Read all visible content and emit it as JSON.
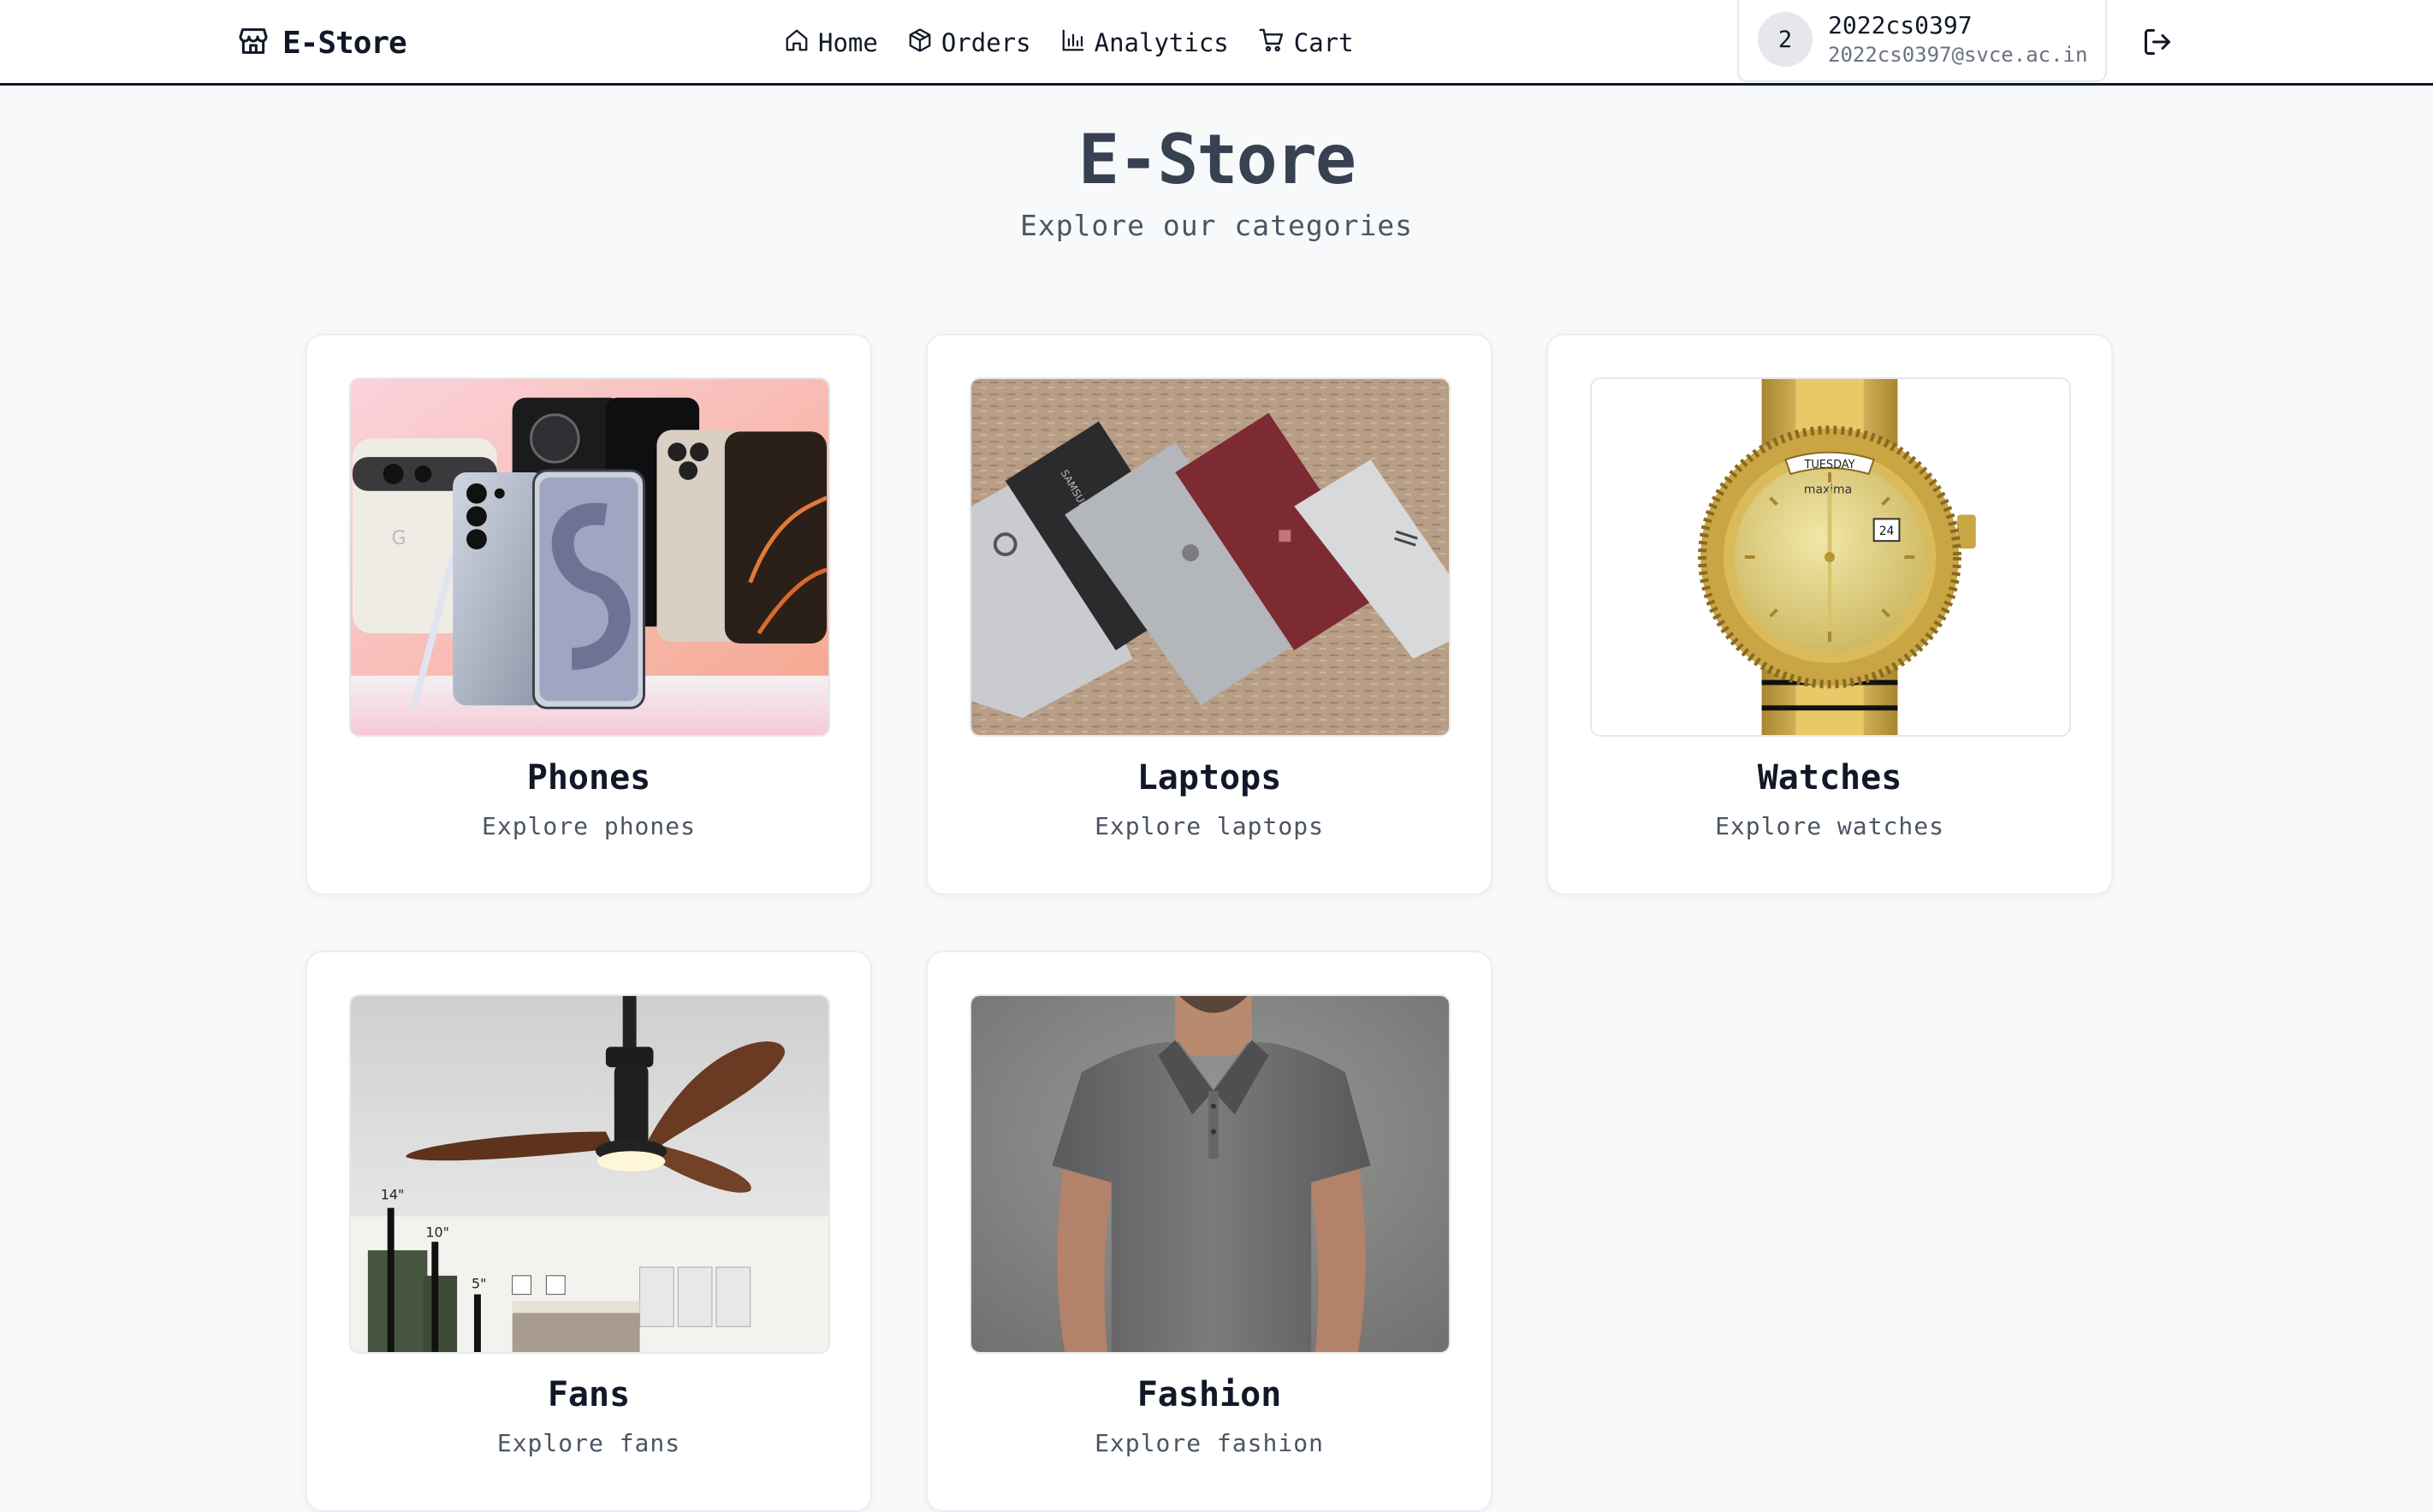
{
  "navbar": {
    "brand": "E-Store",
    "links": [
      {
        "label": "Home",
        "icon": "home-icon"
      },
      {
        "label": "Orders",
        "icon": "package-icon"
      },
      {
        "label": "Analytics",
        "icon": "bar-chart-icon"
      },
      {
        "label": "Cart",
        "icon": "cart-icon"
      }
    ],
    "user": {
      "avatar_initial": "2",
      "name": "2022cs0397",
      "email": "2022cs0397@svce.ac.in"
    },
    "logout_icon": "logout-icon"
  },
  "hero": {
    "title": "E-Store",
    "subtitle": "Explore our categories"
  },
  "categories": [
    {
      "title": "Phones",
      "desc": "Explore phones"
    },
    {
      "title": "Laptops",
      "desc": "Explore laptops"
    },
    {
      "title": "Watches",
      "desc": "Explore watches"
    },
    {
      "title": "Fans",
      "desc": "Explore fans"
    },
    {
      "title": "Fashion",
      "desc": "Explore fashion"
    }
  ],
  "image_text": {
    "laptop_brand": "SAMSUNG",
    "watch_day": "TUESDAY",
    "watch_brand": "maxima",
    "watch_date": "24",
    "fan_sizes": [
      "14\"",
      "10\"",
      "5\""
    ]
  },
  "colors": {
    "accent": "#111827",
    "background": "#f8f9fb",
    "card_border": "#eceef2"
  }
}
